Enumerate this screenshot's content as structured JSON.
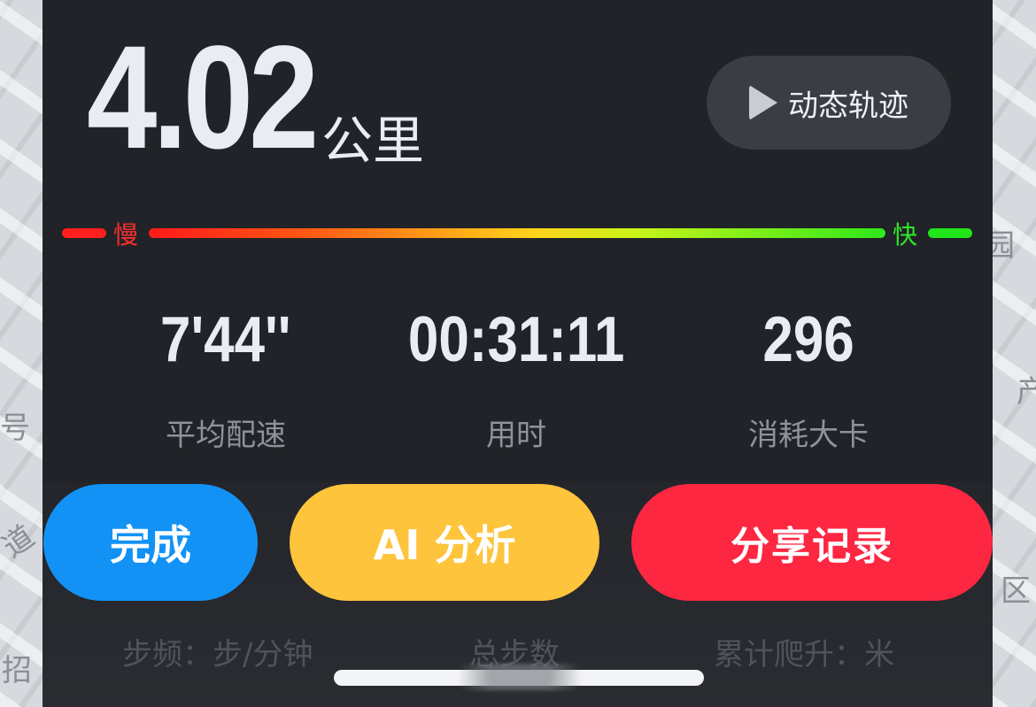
{
  "map": {
    "labels": [
      "号",
      "道",
      "产",
      "区",
      "园",
      "招"
    ]
  },
  "summary": {
    "distance_value": "4.02",
    "distance_unit": "公里"
  },
  "track_button": {
    "label": "动态轨迹",
    "icon": "play-icon"
  },
  "speed_bar": {
    "slow_label": "慢",
    "fast_label": "快",
    "colors": {
      "slow": "#ff1f1f",
      "mid": "#ffd21a",
      "fast": "#22e41a"
    }
  },
  "stats": [
    {
      "value": "7'44''",
      "label": "平均配速"
    },
    {
      "value": "00:31:11",
      "label": "用时"
    },
    {
      "value": "296",
      "label": "消耗大卡"
    }
  ],
  "secondary_stats": [
    {
      "label": "步频：步/分钟"
    },
    {
      "label": "总步数"
    },
    {
      "label": "累计爬升：米"
    }
  ],
  "actions": {
    "done_label": "完成",
    "ai_label": "AI 分析",
    "share_label": "分享记录",
    "colors": {
      "done": "#1292f5",
      "ai": "#fec43c",
      "share": "#fd2742"
    }
  }
}
